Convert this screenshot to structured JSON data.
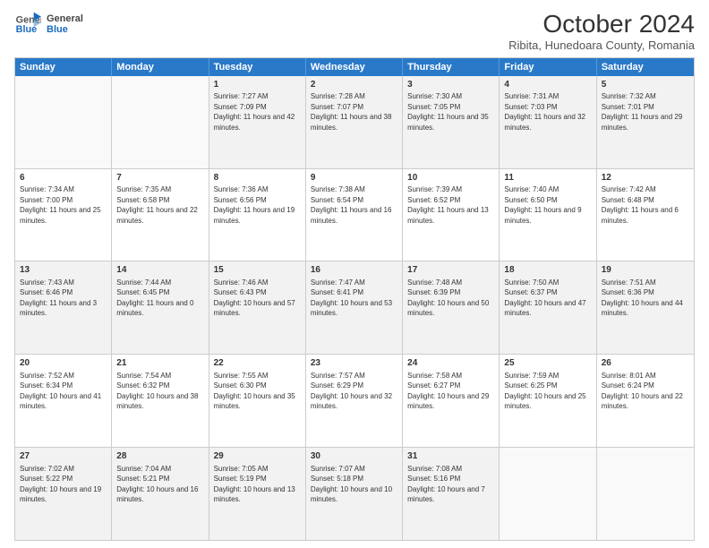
{
  "header": {
    "logo_general": "General",
    "logo_blue": "Blue",
    "month": "October 2024",
    "location": "Ribita, Hunedoara County, Romania"
  },
  "days_of_week": [
    "Sunday",
    "Monday",
    "Tuesday",
    "Wednesday",
    "Thursday",
    "Friday",
    "Saturday"
  ],
  "rows": [
    [
      {
        "day": "",
        "empty": true
      },
      {
        "day": "",
        "empty": true
      },
      {
        "day": "1",
        "sunrise": "Sunrise: 7:27 AM",
        "sunset": "Sunset: 7:09 PM",
        "daylight": "Daylight: 11 hours and 42 minutes."
      },
      {
        "day": "2",
        "sunrise": "Sunrise: 7:28 AM",
        "sunset": "Sunset: 7:07 PM",
        "daylight": "Daylight: 11 hours and 38 minutes."
      },
      {
        "day": "3",
        "sunrise": "Sunrise: 7:30 AM",
        "sunset": "Sunset: 7:05 PM",
        "daylight": "Daylight: 11 hours and 35 minutes."
      },
      {
        "day": "4",
        "sunrise": "Sunrise: 7:31 AM",
        "sunset": "Sunset: 7:03 PM",
        "daylight": "Daylight: 11 hours and 32 minutes."
      },
      {
        "day": "5",
        "sunrise": "Sunrise: 7:32 AM",
        "sunset": "Sunset: 7:01 PM",
        "daylight": "Daylight: 11 hours and 29 minutes."
      }
    ],
    [
      {
        "day": "6",
        "sunrise": "Sunrise: 7:34 AM",
        "sunset": "Sunset: 7:00 PM",
        "daylight": "Daylight: 11 hours and 25 minutes."
      },
      {
        "day": "7",
        "sunrise": "Sunrise: 7:35 AM",
        "sunset": "Sunset: 6:58 PM",
        "daylight": "Daylight: 11 hours and 22 minutes."
      },
      {
        "day": "8",
        "sunrise": "Sunrise: 7:36 AM",
        "sunset": "Sunset: 6:56 PM",
        "daylight": "Daylight: 11 hours and 19 minutes."
      },
      {
        "day": "9",
        "sunrise": "Sunrise: 7:38 AM",
        "sunset": "Sunset: 6:54 PM",
        "daylight": "Daylight: 11 hours and 16 minutes."
      },
      {
        "day": "10",
        "sunrise": "Sunrise: 7:39 AM",
        "sunset": "Sunset: 6:52 PM",
        "daylight": "Daylight: 11 hours and 13 minutes."
      },
      {
        "day": "11",
        "sunrise": "Sunrise: 7:40 AM",
        "sunset": "Sunset: 6:50 PM",
        "daylight": "Daylight: 11 hours and 9 minutes."
      },
      {
        "day": "12",
        "sunrise": "Sunrise: 7:42 AM",
        "sunset": "Sunset: 6:48 PM",
        "daylight": "Daylight: 11 hours and 6 minutes."
      }
    ],
    [
      {
        "day": "13",
        "sunrise": "Sunrise: 7:43 AM",
        "sunset": "Sunset: 6:46 PM",
        "daylight": "Daylight: 11 hours and 3 minutes."
      },
      {
        "day": "14",
        "sunrise": "Sunrise: 7:44 AM",
        "sunset": "Sunset: 6:45 PM",
        "daylight": "Daylight: 11 hours and 0 minutes."
      },
      {
        "day": "15",
        "sunrise": "Sunrise: 7:46 AM",
        "sunset": "Sunset: 6:43 PM",
        "daylight": "Daylight: 10 hours and 57 minutes."
      },
      {
        "day": "16",
        "sunrise": "Sunrise: 7:47 AM",
        "sunset": "Sunset: 6:41 PM",
        "daylight": "Daylight: 10 hours and 53 minutes."
      },
      {
        "day": "17",
        "sunrise": "Sunrise: 7:48 AM",
        "sunset": "Sunset: 6:39 PM",
        "daylight": "Daylight: 10 hours and 50 minutes."
      },
      {
        "day": "18",
        "sunrise": "Sunrise: 7:50 AM",
        "sunset": "Sunset: 6:37 PM",
        "daylight": "Daylight: 10 hours and 47 minutes."
      },
      {
        "day": "19",
        "sunrise": "Sunrise: 7:51 AM",
        "sunset": "Sunset: 6:36 PM",
        "daylight": "Daylight: 10 hours and 44 minutes."
      }
    ],
    [
      {
        "day": "20",
        "sunrise": "Sunrise: 7:52 AM",
        "sunset": "Sunset: 6:34 PM",
        "daylight": "Daylight: 10 hours and 41 minutes."
      },
      {
        "day": "21",
        "sunrise": "Sunrise: 7:54 AM",
        "sunset": "Sunset: 6:32 PM",
        "daylight": "Daylight: 10 hours and 38 minutes."
      },
      {
        "day": "22",
        "sunrise": "Sunrise: 7:55 AM",
        "sunset": "Sunset: 6:30 PM",
        "daylight": "Daylight: 10 hours and 35 minutes."
      },
      {
        "day": "23",
        "sunrise": "Sunrise: 7:57 AM",
        "sunset": "Sunset: 6:29 PM",
        "daylight": "Daylight: 10 hours and 32 minutes."
      },
      {
        "day": "24",
        "sunrise": "Sunrise: 7:58 AM",
        "sunset": "Sunset: 6:27 PM",
        "daylight": "Daylight: 10 hours and 29 minutes."
      },
      {
        "day": "25",
        "sunrise": "Sunrise: 7:59 AM",
        "sunset": "Sunset: 6:25 PM",
        "daylight": "Daylight: 10 hours and 25 minutes."
      },
      {
        "day": "26",
        "sunrise": "Sunrise: 8:01 AM",
        "sunset": "Sunset: 6:24 PM",
        "daylight": "Daylight: 10 hours and 22 minutes."
      }
    ],
    [
      {
        "day": "27",
        "sunrise": "Sunrise: 7:02 AM",
        "sunset": "Sunset: 5:22 PM",
        "daylight": "Daylight: 10 hours and 19 minutes."
      },
      {
        "day": "28",
        "sunrise": "Sunrise: 7:04 AM",
        "sunset": "Sunset: 5:21 PM",
        "daylight": "Daylight: 10 hours and 16 minutes."
      },
      {
        "day": "29",
        "sunrise": "Sunrise: 7:05 AM",
        "sunset": "Sunset: 5:19 PM",
        "daylight": "Daylight: 10 hours and 13 minutes."
      },
      {
        "day": "30",
        "sunrise": "Sunrise: 7:07 AM",
        "sunset": "Sunset: 5:18 PM",
        "daylight": "Daylight: 10 hours and 10 minutes."
      },
      {
        "day": "31",
        "sunrise": "Sunrise: 7:08 AM",
        "sunset": "Sunset: 5:16 PM",
        "daylight": "Daylight: 10 hours and 7 minutes."
      },
      {
        "day": "",
        "empty": true
      },
      {
        "day": "",
        "empty": true
      }
    ]
  ]
}
